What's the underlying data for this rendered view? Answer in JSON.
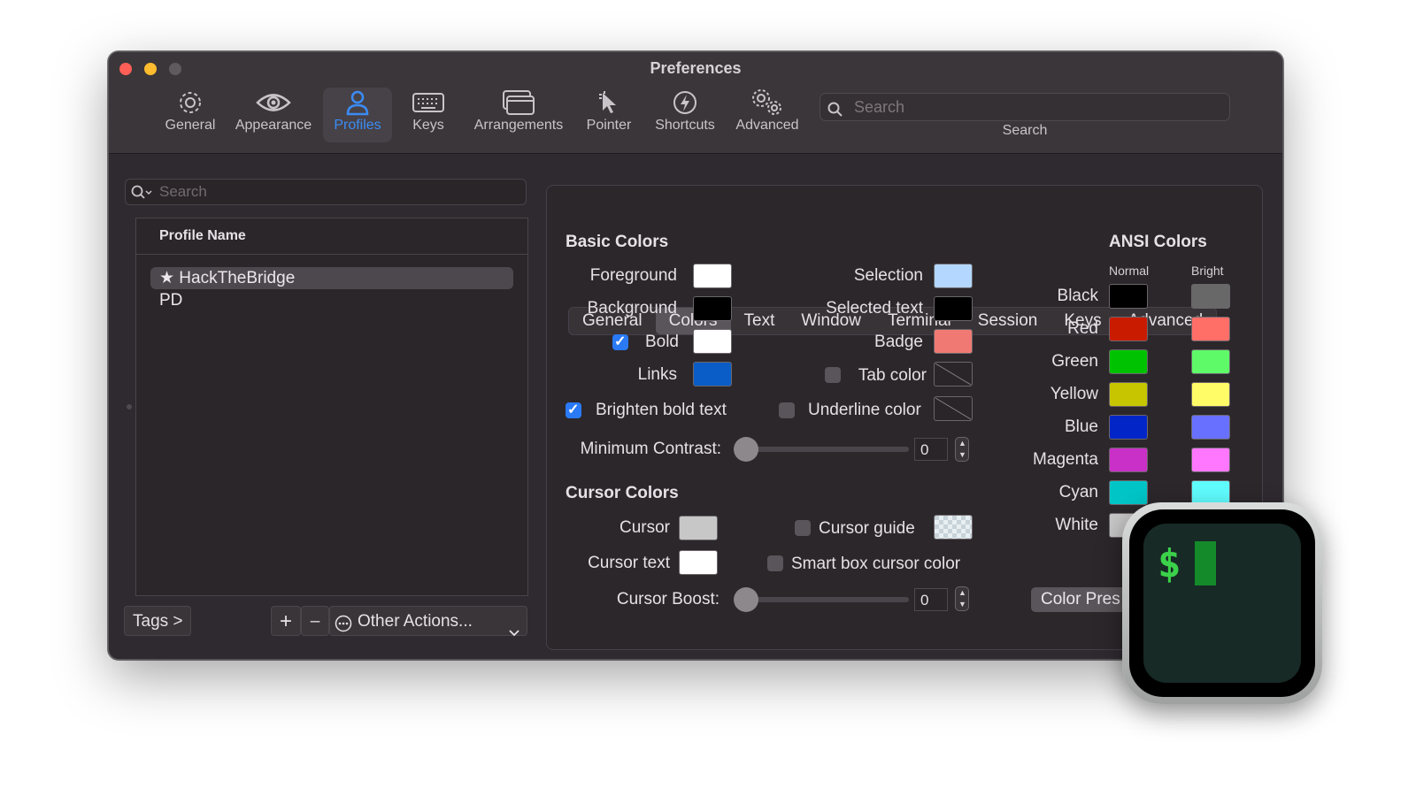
{
  "window": {
    "title": "Preferences"
  },
  "toolbar": {
    "items": [
      {
        "label": "General",
        "icon": "gear-icon"
      },
      {
        "label": "Appearance",
        "icon": "eye-icon"
      },
      {
        "label": "Profiles",
        "icon": "person-icon"
      },
      {
        "label": "Keys",
        "icon": "keyboard-icon"
      },
      {
        "label": "Arrangements",
        "icon": "windows-icon"
      },
      {
        "label": "Pointer",
        "icon": "pointer-icon"
      },
      {
        "label": "Shortcuts",
        "icon": "bolt-icon"
      },
      {
        "label": "Advanced",
        "icon": "gears-icon"
      }
    ],
    "active": "Profiles",
    "search_placeholder": "Search",
    "search_label": "Search"
  },
  "profiles": {
    "search_placeholder": "Search",
    "column_header": "Profile Name",
    "rows": [
      {
        "name": "★ HackTheBridge",
        "selected": true
      },
      {
        "name": "PD",
        "selected": false
      }
    ],
    "tags_button": "Tags >",
    "add_button": "+",
    "remove_button": "–",
    "other_actions": "Other Actions..."
  },
  "tabs": [
    "General",
    "Colors",
    "Text",
    "Window",
    "Terminal",
    "Session",
    "Keys",
    "Advanced"
  ],
  "active_tab": "Colors",
  "basic_colors": {
    "header": "Basic Colors",
    "foreground": {
      "label": "Foreground",
      "color": "#ffffff"
    },
    "background": {
      "label": "Background",
      "color": "#000000"
    },
    "bold": {
      "label": "Bold",
      "color": "#ffffff",
      "checked": true
    },
    "links": {
      "label": "Links",
      "color": "#0a5cc7"
    },
    "selection": {
      "label": "Selection",
      "color": "#b3d7ff"
    },
    "selected_text": {
      "label": "Selected text",
      "color": "#000000"
    },
    "badge": {
      "label": "Badge",
      "color": "#f07a73"
    },
    "tab_color": {
      "label": "Tab color",
      "checked": false
    },
    "brighten_bold": {
      "label": "Brighten bold text",
      "checked": true
    },
    "underline_color": {
      "label": "Underline color",
      "checked": false
    },
    "min_contrast": {
      "label": "Minimum Contrast:",
      "value": "0"
    }
  },
  "cursor_colors": {
    "header": "Cursor Colors",
    "cursor": {
      "label": "Cursor",
      "color": "#c7c7c7"
    },
    "cursor_text": {
      "label": "Cursor text",
      "color": "#ffffff"
    },
    "cursor_guide": {
      "label": "Cursor guide",
      "checked": false
    },
    "smart_box": {
      "label": "Smart box cursor color",
      "checked": false
    },
    "cursor_boost": {
      "label": "Cursor Boost:",
      "value": "0"
    }
  },
  "ansi": {
    "header": "ANSI Colors",
    "normal_label": "Normal",
    "bright_label": "Bright",
    "rows": [
      {
        "name": "Black",
        "normal": "#000000",
        "bright": "#686868"
      },
      {
        "name": "Red",
        "normal": "#c91b00",
        "bright": "#ff6e67"
      },
      {
        "name": "Green",
        "normal": "#00c200",
        "bright": "#5ffa68"
      },
      {
        "name": "Yellow",
        "normal": "#c7c400",
        "bright": "#fffc67"
      },
      {
        "name": "Blue",
        "normal": "#0225c7",
        "bright": "#6871ff"
      },
      {
        "name": "Magenta",
        "normal": "#c930c7",
        "bright": "#ff77ff"
      },
      {
        "name": "Cyan",
        "normal": "#00c5c7",
        "bright": "#60fdff"
      },
      {
        "name": "White",
        "normal": "#c7c7c7",
        "bright": "#ffffff"
      }
    ]
  },
  "color_presets_button": "Color Pres",
  "app_icon": {
    "prompt": "$"
  }
}
